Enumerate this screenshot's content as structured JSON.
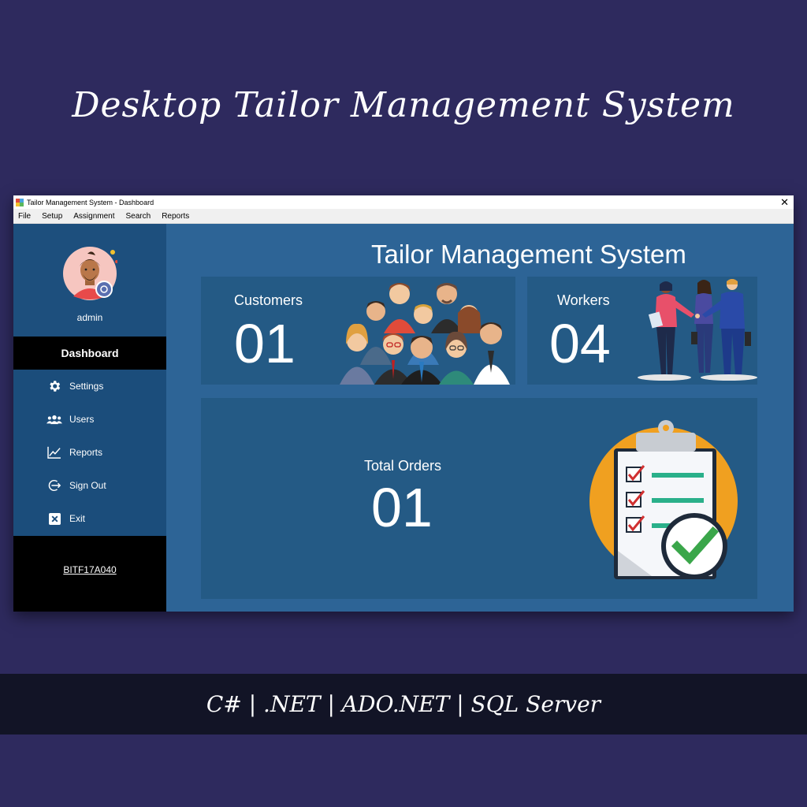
{
  "promo": {
    "title": "Desktop Tailor Management System",
    "tech_stack": "C# | .NET | ADO.NET | SQL Server"
  },
  "window": {
    "title": "Tailor Management System - Dashboard",
    "close_symbol": "✕"
  },
  "menu": [
    "File",
    "Setup",
    "Assignment",
    "Search",
    "Reports"
  ],
  "sidebar": {
    "username": "admin",
    "dashboard_label": "Dashboard",
    "items": [
      {
        "label": "Settings",
        "icon": "gear-icon"
      },
      {
        "label": "Users",
        "icon": "users-icon"
      },
      {
        "label": "Reports",
        "icon": "chart-line-icon"
      },
      {
        "label": "Sign Out",
        "icon": "sign-out-icon"
      },
      {
        "label": "Exit",
        "icon": "exit-icon"
      }
    ],
    "footer_link": "BITF17A040"
  },
  "main": {
    "title": "Tailor Management System",
    "customers": {
      "label": "Customers",
      "value": "01"
    },
    "workers": {
      "label": "Workers",
      "value": "04"
    },
    "orders": {
      "label": "Total Orders",
      "value": "01"
    }
  },
  "colors": {
    "page_bg": "#2e2a5e",
    "main_bg": "#2d6496",
    "card_bg": "#245a85",
    "sidebar_bg": "#1d4f7d",
    "accent_orange": "#f0a020",
    "check_green": "#3aa64a"
  }
}
